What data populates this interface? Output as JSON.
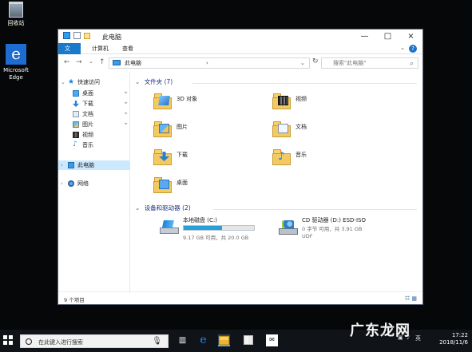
{
  "desktop": {
    "icons": [
      {
        "label": "回收站"
      },
      {
        "label": "Microsoft Edge"
      }
    ]
  },
  "window": {
    "title": "此电脑",
    "ribbon_tabs": [
      "文件",
      "计算机",
      "查看"
    ],
    "address": "此电脑",
    "search_placeholder": "搜索\"此电脑\"",
    "status": "9 个项目"
  },
  "sidebar": {
    "items": [
      {
        "label": "快速访问",
        "icon": "star-icon"
      },
      {
        "label": "桌面",
        "icon": "desktop-folder-icon",
        "pinned": true
      },
      {
        "label": "下载",
        "icon": "downloads-icon",
        "pinned": true
      },
      {
        "label": "文档",
        "icon": "documents-icon",
        "pinned": true
      },
      {
        "label": "图片",
        "icon": "pictures-icon",
        "pinned": true
      },
      {
        "label": "视频",
        "icon": "videos-icon"
      },
      {
        "label": "音乐",
        "icon": "music-icon"
      },
      {
        "label": "此电脑",
        "icon": "computer-icon",
        "selected": true
      },
      {
        "label": "网络",
        "icon": "network-icon"
      }
    ]
  },
  "content": {
    "folders_title": "文件夹 (7)",
    "folders": [
      {
        "name": "3D 对象",
        "icon": "3d-objects-icon"
      },
      {
        "name": "视频",
        "icon": "videos-folder-icon"
      },
      {
        "name": "图片",
        "icon": "pictures-folder-icon"
      },
      {
        "name": "文档",
        "icon": "documents-folder-icon"
      },
      {
        "name": "下载",
        "icon": "downloads-folder-icon"
      },
      {
        "name": "音乐",
        "icon": "music-folder-icon"
      },
      {
        "name": "桌面",
        "icon": "desktop-folder-icon"
      }
    ],
    "devices_title": "设备和驱动器 (2)",
    "drives": [
      {
        "name": "本地磁盘 (C:)",
        "detail": "9.17 GB 可用，共 20.0 GB",
        "used_fraction": 0.54
      },
      {
        "name": "CD 驱动器 (D:) ESD-ISO",
        "detail_1": "0 字节 可用，共 3.91 GB",
        "detail_2": "UDF"
      }
    ]
  },
  "taskbar": {
    "search_placeholder": "在此键入进行搜索",
    "tray": {
      "input_language": "英",
      "time": "17:22",
      "date": "2018/11/6"
    }
  },
  "watermark": "广东龙网",
  "colors": {
    "accent": "#1979ca",
    "selection": "#cce8ff",
    "drive_fill": "#26a0da",
    "taskbar": "#101317"
  }
}
